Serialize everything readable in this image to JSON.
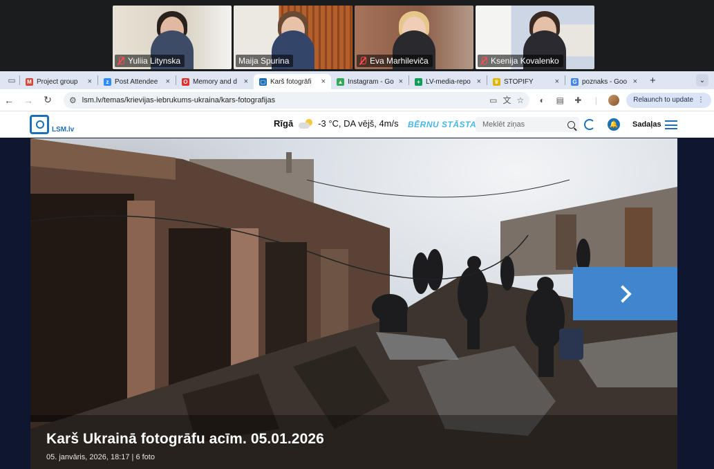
{
  "call": {
    "participants": [
      {
        "name": "Yuliia Litynska",
        "muted": true
      },
      {
        "name": "Maija Spurina",
        "muted": false,
        "speaking": true
      },
      {
        "name": "Eva Marhileviča",
        "muted": true
      },
      {
        "name": "Ksenija Kovalenko",
        "muted": true
      }
    ]
  },
  "tabs": [
    {
      "label": "Project group",
      "favicon": "gmail-icon",
      "color": "#d44638",
      "glyph": "M"
    },
    {
      "label": "Post Attendee",
      "favicon": "zoom-icon",
      "color": "#2d8cff",
      "glyph": "z"
    },
    {
      "label": "Memory and d",
      "favicon": "opera-icon",
      "color": "#e0312b",
      "glyph": "O"
    },
    {
      "label": "Karš fotogrāfi",
      "favicon": "lsm-icon",
      "color": "#1c6fb4",
      "glyph": "▢",
      "active": true
    },
    {
      "label": "Instagram - Go",
      "favicon": "drive-icon",
      "color": "#34a853",
      "glyph": "▲"
    },
    {
      "label": "LV-media-repo",
      "favicon": "sheets-icon",
      "color": "#0f9d58",
      "glyph": "+"
    },
    {
      "label": "STOPIFY",
      "favicon": "crown-icon",
      "color": "#e2b400",
      "glyph": "♛"
    },
    {
      "label": "poznaks - Goo",
      "favicon": "google-icon",
      "color": "#4285f4",
      "glyph": "G"
    }
  ],
  "toolbar": {
    "url": "lsm.lv/temas/krievijas-iebrukums-ukraina/kars-fotografijas",
    "relaunch_label": "Relaunch to update"
  },
  "site": {
    "logo_text": "LSM.lv",
    "city": "Rīgā",
    "weather": "-3 °C, DA vējš, 4m/s",
    "bernu_label": "BĒRNU STĀSTA",
    "search_placeholder": "Meklēt ziņas",
    "menu_label": "Sadaļas"
  },
  "gallery": {
    "title": "Karš Ukrainā fotogrāfu acīm. 05.01.2026",
    "meta": "05. janvāris, 2026, 18:17 | 6 foto"
  },
  "colors": {
    "lsm_blue": "#1c6fb4",
    "next_button": "#3f86cf",
    "active_speaker": "#2fd46c"
  }
}
